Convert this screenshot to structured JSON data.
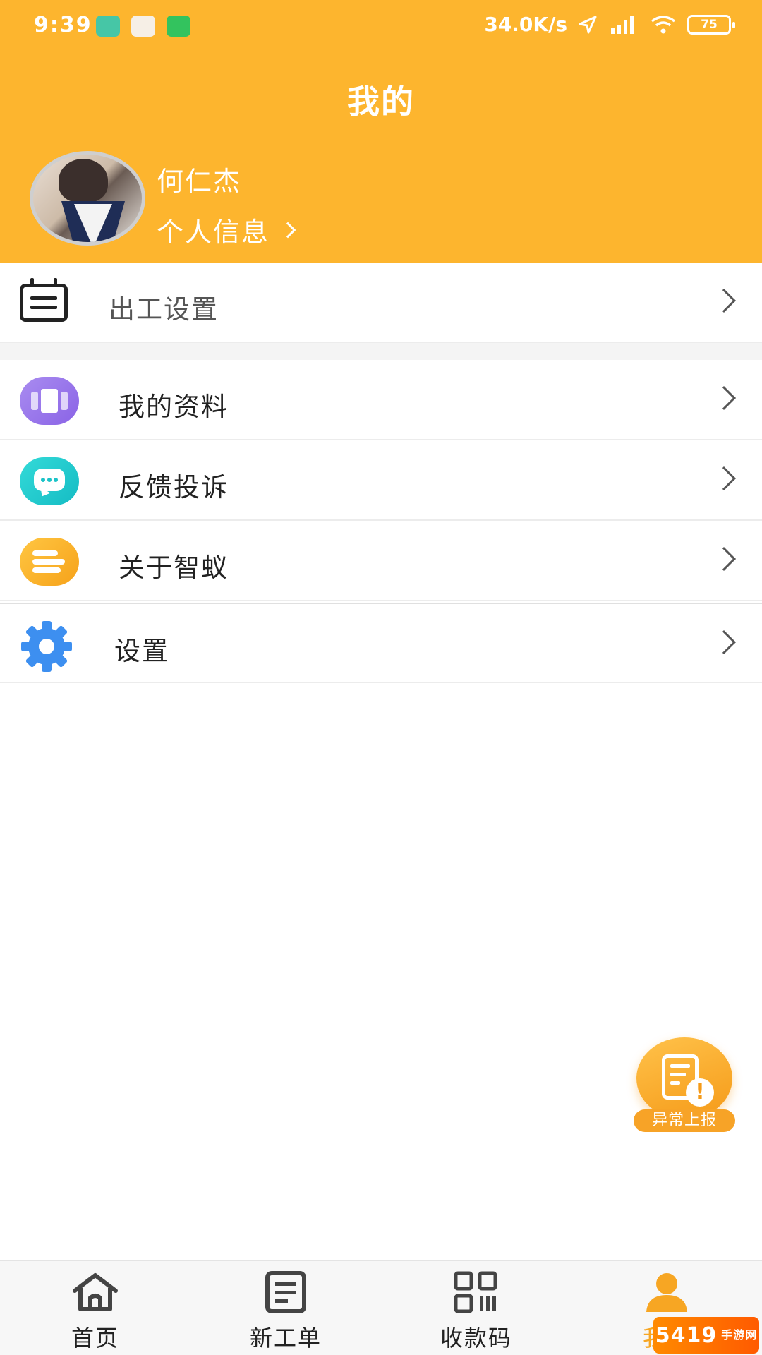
{
  "status_bar": {
    "time": "9:39",
    "network_speed": "34.0K/s",
    "battery": "75"
  },
  "header": {
    "title": "我的",
    "user_name": "何仁杰",
    "profile_link": "个人信息"
  },
  "menu": {
    "work_settings": "出工设置",
    "my_profile": "我的资料",
    "feedback": "反馈投诉",
    "about": "关于智蚁",
    "settings": "设置"
  },
  "fab": {
    "label": "异常上报"
  },
  "tabbar": {
    "home": "首页",
    "new_order": "新工单",
    "payment_code": "收款码",
    "mine": "我的"
  },
  "watermark": {
    "brand": "5419",
    "sub": "手游网"
  },
  "colors": {
    "header_bg": "#FDB52E",
    "active_tab": "#f7a623"
  }
}
